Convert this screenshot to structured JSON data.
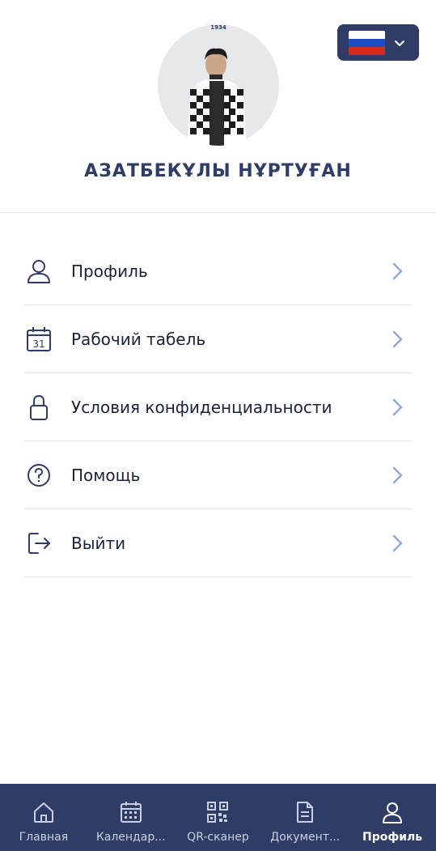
{
  "header": {
    "avatar_year": "1934",
    "user_name": "АЗАТБЕКҰЛЫ НҰРТУҒАН",
    "language": {
      "selected": "ru",
      "icon": "russia-flag-icon"
    }
  },
  "menu": {
    "items": [
      {
        "label": "Профиль",
        "icon": "user-icon"
      },
      {
        "label": "Рабочий табель",
        "icon": "calendar-31-icon"
      },
      {
        "label": "Условия конфиденциальности",
        "icon": "lock-icon"
      },
      {
        "label": "Помощь",
        "icon": "help-circle-icon"
      },
      {
        "label": "Выйти",
        "icon": "logout-icon"
      }
    ]
  },
  "bottom_nav": {
    "items": [
      {
        "label": "Главная",
        "icon": "home-icon"
      },
      {
        "label": "Календар...",
        "icon": "calendar-icon"
      },
      {
        "label": "QR-сканер",
        "icon": "qr-icon"
      },
      {
        "label": "Документ...",
        "icon": "document-icon"
      },
      {
        "label": "Профиль",
        "icon": "profile-icon"
      }
    ],
    "active_index": 4
  },
  "colors": {
    "accent": "#2f3d66",
    "arrow": "#8fa9d6",
    "text": "#1a2238"
  }
}
